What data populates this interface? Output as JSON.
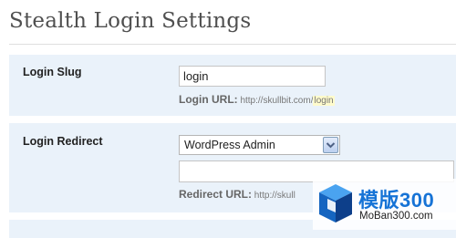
{
  "page": {
    "title": "Stealth Login Settings"
  },
  "login_slug": {
    "label": "Login Slug",
    "value": "login",
    "help_label": "Login URL",
    "help_separator": ":",
    "help_url_prefix": "http://skullbit.com/",
    "help_url_slug": "login"
  },
  "login_redirect": {
    "label": "Login Redirect",
    "selected_option": "WordPress Admin",
    "custom_url_value": "",
    "help_label": "Redirect URL",
    "help_separator": ":",
    "help_url_prefix": "http://skull"
  },
  "watermark": {
    "text": "模版300",
    "url": "MoBan300.com"
  },
  "icons": {
    "dropdown": "chevron-down-icon",
    "watermark_logo": "cube-logo-icon"
  },
  "colors": {
    "row_background": "#eaf2fa",
    "title": "#4f4f4f",
    "highlight": "#fffbcc",
    "watermark_blue": "#1673d6"
  }
}
